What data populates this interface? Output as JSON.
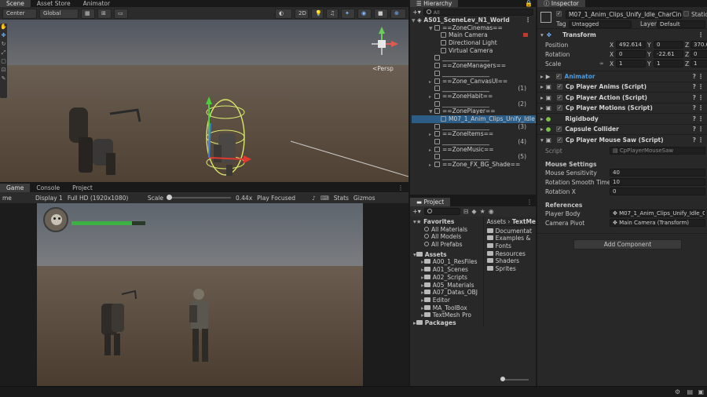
{
  "scene_panel": {
    "tabs": [
      "Scene",
      "Asset Store",
      "Animator"
    ],
    "toolbar": {
      "pivot": "Center",
      "space": "Global",
      "mode_2d": "2D"
    },
    "persp_label": "<Persp"
  },
  "game_panel": {
    "tabs": [
      "Game",
      "Console",
      "Project"
    ],
    "toolbar": {
      "view": "me",
      "display": "Display 1",
      "resolution": "Full HD (1920x1080)",
      "scale_label": "Scale",
      "scale_value": "0.44x",
      "play_mode": "Play Focused",
      "stats": "Stats",
      "gizmos": "Gizmos"
    },
    "health_fill": 0.82,
    "health_color": "#3cb043"
  },
  "hierarchy": {
    "title": "Hierarchy",
    "search_placeholder": "All",
    "scene_name": "AS01_SceneLev_N1_World",
    "rows": [
      {
        "label": "==ZoneCinemas==",
        "num": ""
      },
      {
        "label": "Main Camera",
        "num": ""
      },
      {
        "label": "Directional Light",
        "num": ""
      },
      {
        "label": "Virtual Camera",
        "num": ""
      },
      {
        "label": "________________",
        "num": ""
      },
      {
        "label": "==ZoneManagers==",
        "num": ""
      },
      {
        "label": "________________",
        "num": ""
      },
      {
        "label": "==Zone_CanvasUI==",
        "num": ""
      },
      {
        "label": "________________",
        "num": "(1)"
      },
      {
        "label": "==ZoneHabit==",
        "num": ""
      },
      {
        "label": "________________",
        "num": "(2)"
      },
      {
        "label": "==ZonePlayer==",
        "num": ""
      },
      {
        "label": "M07_1_Anim_Clips_Unify_Idle_",
        "num": ""
      },
      {
        "label": "________________",
        "num": "(3)"
      },
      {
        "label": "==ZoneItems==",
        "num": ""
      },
      {
        "label": "________________",
        "num": "(4)"
      },
      {
        "label": "==ZoneMusic==",
        "num": ""
      },
      {
        "label": "________________",
        "num": "(5)"
      },
      {
        "label": "==Zone_FX_BG_Shade==",
        "num": ""
      }
    ]
  },
  "project": {
    "title": "Project",
    "favorites_label": "Favorites",
    "favorites": [
      "All Materials",
      "All Models",
      "All Prefabs"
    ],
    "assets_label": "Assets",
    "assets": [
      "A00_1_ResFiles",
      "A01_Scenes",
      "A02_Scripts",
      "A05_Materials",
      "A07_Datas_OBJ",
      "Editor",
      "MA_ToolBox",
      "TextMesh Pro"
    ],
    "packages_label": "Packages",
    "breadcrumb": [
      "Assets",
      "TextMe"
    ],
    "right_items": [
      "Documentat",
      "Examples &",
      "Fonts",
      "Resources",
      "Shaders",
      "Sprites"
    ]
  },
  "inspector": {
    "title": "Inspector",
    "object_name": "M07_1_Anim_Clips_Unify_Idle_CharCin",
    "static_label": "Static",
    "tag_label": "Tag",
    "tag_value": "Untagged",
    "layer_label": "Layer",
    "layer_value": "Default",
    "transform": {
      "title": "Transform",
      "position_label": "Position",
      "rotation_label": "Rotation",
      "scale_label": "Scale",
      "position": {
        "x": "492.614",
        "y": "0",
        "z": "370.6"
      },
      "rotation": {
        "x": "0",
        "y": "-22.61",
        "z": "0"
      },
      "scale": {
        "x": "1",
        "y": "1",
        "z": "1"
      }
    },
    "components": [
      {
        "name": "Animator",
        "highlight": true
      },
      {
        "name": "Cp Player Anims (Script)",
        "highlight": false
      },
      {
        "name": "Cp Player Action (Script)",
        "highlight": false
      },
      {
        "name": "Cp Player Motions (Script)",
        "highlight": false
      },
      {
        "name": "Rigidbody",
        "highlight": false
      },
      {
        "name": "Capsule Collider",
        "highlight": false
      },
      {
        "name": "Cp Player Mouse Saw (Script)",
        "highlight": false
      }
    ],
    "script_label": "Script",
    "script_value": "CpPlayerMouseSaw",
    "mouse_settings_heading": "Mouse Settings",
    "mouse_sensitivity_label": "Mouse Sensitivity",
    "mouse_sensitivity_value": "40",
    "rotation_smooth_label": "Rotation Smooth Time",
    "rotation_smooth_value": "10",
    "rotation_x_label": "Rotation X",
    "rotation_x_value": "0",
    "references_heading": "References",
    "player_body_label": "Player Body",
    "player_body_value": "M07_1_Anim_Clips_Unify_Idle_Ch",
    "camera_pivot_label": "Camera Pivot",
    "camera_pivot_value": "Main Camera (Transform)",
    "add_component_label": "Add Component",
    "accent_color": "#4c9bde"
  }
}
